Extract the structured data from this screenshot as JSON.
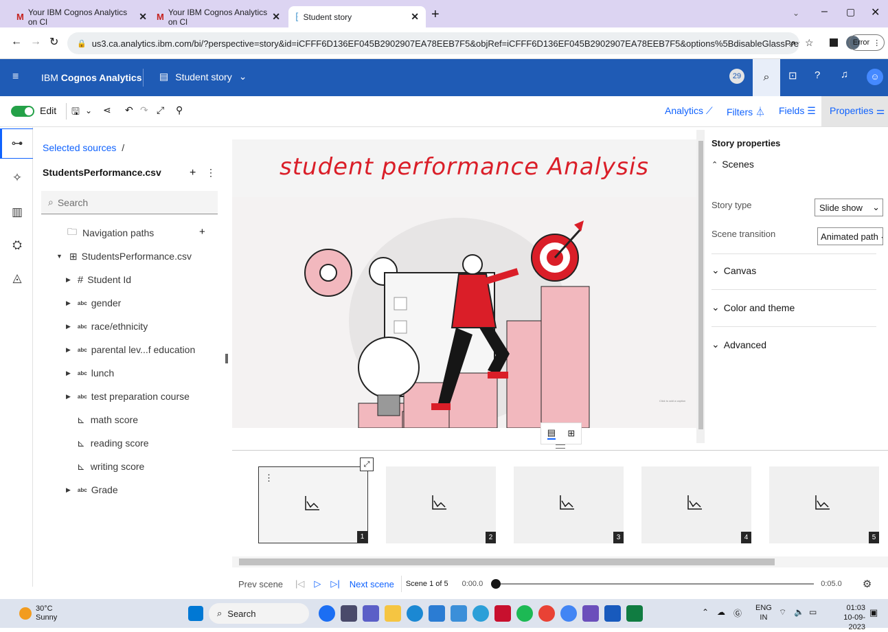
{
  "browser": {
    "tabs": [
      {
        "title": "Your IBM Cognos Analytics on Cl"
      },
      {
        "title": "Your IBM Cognos Analytics on Cl"
      },
      {
        "title": "Student story"
      }
    ],
    "url": "us3.ca.analytics.ibm.com/bi/?perspective=story&id=iCFFF6D136EF045B2902907EA78EEB7F5&objRef=iCFFF6D136EF045B2902907EA78EEB7F5&options%5BdisableGlassPrefetch%5D=true&...",
    "error_label": "Error"
  },
  "app": {
    "product": "IBM",
    "product_bold": "Cognos Analytics",
    "doc_title": "Student story",
    "badge_count": "29"
  },
  "toolbar": {
    "edit_label": "Edit",
    "analytics": "Analytics",
    "filters": "Filters",
    "fields": "Fields",
    "properties": "Properties"
  },
  "datapanel": {
    "breadcrumb": "Selected sources",
    "breadcrumb_sep": "/",
    "source": "StudentsPerformance.csv",
    "search_placeholder": "Search",
    "nav_paths": "Navigation paths",
    "table": "StudentsPerformance.csv",
    "fields": [
      {
        "type": "#",
        "label": "Student Id",
        "expandable": true
      },
      {
        "type": "abc",
        "label": "gender",
        "expandable": true
      },
      {
        "type": "abc",
        "label": "race/ethnicity",
        "expandable": true
      },
      {
        "type": "abc",
        "label": "parental lev...f education",
        "expandable": true
      },
      {
        "type": "abc",
        "label": "lunch",
        "expandable": true
      },
      {
        "type": "abc",
        "label": "test preparation course",
        "expandable": true
      },
      {
        "type": "measure",
        "label": "math score",
        "expandable": false
      },
      {
        "type": "measure",
        "label": "reading score",
        "expandable": false
      },
      {
        "type": "measure",
        "label": "writing score",
        "expandable": false
      },
      {
        "type": "abc",
        "label": "Grade",
        "expandable": true
      }
    ]
  },
  "canvas": {
    "title": "student performance Analysis",
    "tiny_note": "Click to add a caption"
  },
  "properties": {
    "heading": "Story properties",
    "scenes": "Scenes",
    "story_type_label": "Story type",
    "story_type_value": "Slide show",
    "transition_label": "Scene transition",
    "transition_value": "Animated path",
    "canvas": "Canvas",
    "color_theme": "Color and theme",
    "advanced": "Advanced"
  },
  "scenes": [
    "1",
    "2",
    "3",
    "4",
    "5"
  ],
  "player": {
    "prev": "Prev scene",
    "next": "Next scene",
    "scene_counter": "Scene 1 of 5",
    "time_start": "0:00.0",
    "time_end": "0:05.0",
    "progress": 0
  },
  "taskbar": {
    "temp": "30°C",
    "weather": "Sunny",
    "search": "Search",
    "lang1": "ENG",
    "lang2": "IN",
    "time": "01:03",
    "date": "10-09-2023"
  },
  "colors": {
    "ibm_blue": "#1f5bb5",
    "link_blue": "#0f62fe",
    "title_red": "#da1e28",
    "tab_bg": "#dcd4f2"
  }
}
